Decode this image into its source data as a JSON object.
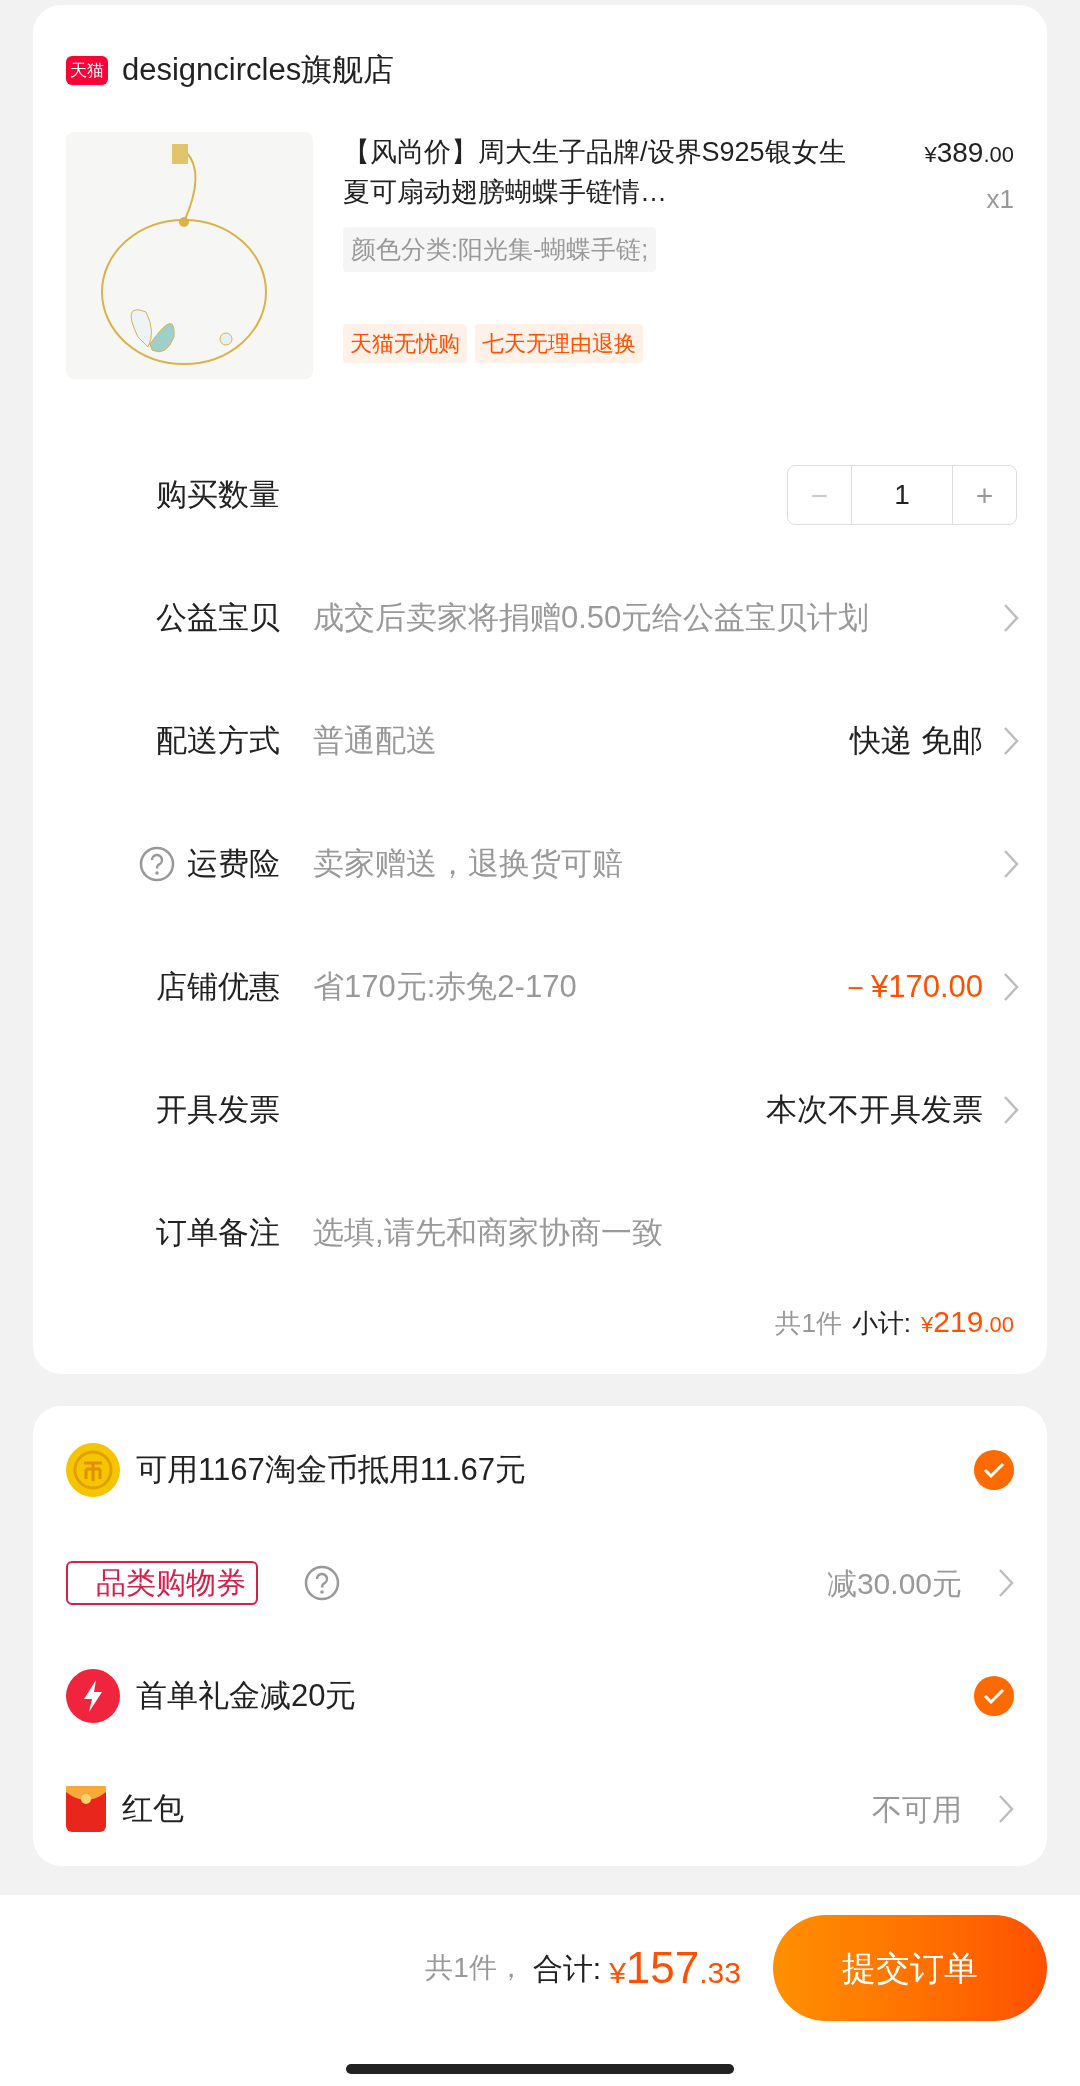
{
  "store": {
    "badge": "天猫",
    "name": "designcircles旗舰店"
  },
  "product": {
    "title": "【风尚价】周大生子品牌/设界S925银女生夏可扇动翅膀蝴蝶手链情…",
    "currency": "¥",
    "price_int": "389",
    "price_dec": ".00",
    "quantity": "x1",
    "sku": "颜色分类:阳光集-蝴蝶手链;",
    "tags": [
      "天猫无忧购",
      "七天无理由退换"
    ]
  },
  "rows": [
    {
      "kind": "stepper",
      "label": "购买数量",
      "minus": "−",
      "value": "1",
      "plus": "+"
    },
    {
      "kind": "info",
      "label": "公益宝贝",
      "value": "成交后卖家将捐赠0.50元给公益宝贝计划"
    },
    {
      "kind": "info",
      "label": "配送方式",
      "value": "普通配送",
      "detail": "快递 免邮"
    },
    {
      "kind": "info",
      "label": "运费险",
      "help": true,
      "value": "卖家赠送，退换货可赔"
    },
    {
      "kind": "discount",
      "label": "店铺优惠",
      "value": "省170元:赤兔2-170",
      "detail": "－¥170.00"
    },
    {
      "kind": "info",
      "label": "开具发票",
      "detail": "本次不开具发票"
    },
    {
      "kind": "input",
      "label": "订单备注",
      "placeholder": "选填,请先和商家协商一致"
    }
  ],
  "subtotal": {
    "count": "共1件",
    "label": "小计:",
    "currency": "¥",
    "int": "219",
    "dec": ".00"
  },
  "benefits": [
    {
      "kind": "coin",
      "text": "可用1167淘金币抵用11.67元",
      "checked": true
    },
    {
      "kind": "coupon",
      "text": "品类购物券",
      "detail": "减30.00元"
    },
    {
      "kind": "bonus",
      "text": "首单礼金减20元",
      "checked": true
    },
    {
      "kind": "red_packet",
      "text": "红包",
      "detail": "不可用"
    }
  ],
  "footer": {
    "count": "共1件，",
    "label": "合计:",
    "currency": "¥",
    "int": "157",
    "dec": ".33",
    "button": "提交订单"
  }
}
